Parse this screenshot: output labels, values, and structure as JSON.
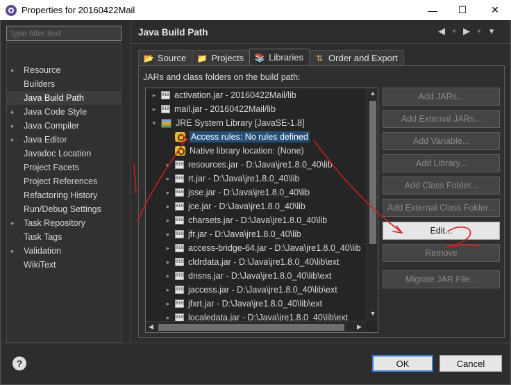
{
  "window": {
    "title": "Properties for 20160422Mail",
    "minimize_glyph": "—",
    "maximize_glyph": "☐",
    "close_glyph": "✕"
  },
  "filter": {
    "placeholder": "type filter text"
  },
  "nav": [
    {
      "label": "Resource",
      "arrow": "▸",
      "selected": false
    },
    {
      "label": "Builders",
      "arrow": "",
      "selected": false
    },
    {
      "label": "Java Build Path",
      "arrow": "",
      "selected": true
    },
    {
      "label": "Java Code Style",
      "arrow": "▸",
      "selected": false
    },
    {
      "label": "Java Compiler",
      "arrow": "▸",
      "selected": false
    },
    {
      "label": "Java Editor",
      "arrow": "▸",
      "selected": false
    },
    {
      "label": "Javadoc Location",
      "arrow": "",
      "selected": false
    },
    {
      "label": "Project Facets",
      "arrow": "",
      "selected": false
    },
    {
      "label": "Project References",
      "arrow": "",
      "selected": false
    },
    {
      "label": "Refactoring History",
      "arrow": "",
      "selected": false
    },
    {
      "label": "Run/Debug Settings",
      "arrow": "",
      "selected": false
    },
    {
      "label": "Task Repository",
      "arrow": "▸",
      "selected": false
    },
    {
      "label": "Task Tags",
      "arrow": "",
      "selected": false
    },
    {
      "label": "Validation",
      "arrow": "▸",
      "selected": false
    },
    {
      "label": "WikiText",
      "arrow": "",
      "selected": false
    }
  ],
  "header": {
    "title": "Java Build Path",
    "back_glyph": "◀",
    "forward_glyph": "▶",
    "menu_glyph": "▾"
  },
  "tabs": [
    {
      "label": "Source",
      "icon": "source-folder-icon",
      "active": false
    },
    {
      "label": "Projects",
      "icon": "projects-icon",
      "active": false
    },
    {
      "label": "Libraries",
      "icon": "libraries-icon",
      "active": true
    },
    {
      "label": "Order and Export",
      "icon": "order-export-icon",
      "active": false
    }
  ],
  "panel_label": "JARs and class folders on the build path:",
  "tree": [
    {
      "text": "activation.jar - 20160422Mail/lib",
      "indent": 0,
      "toggle": "▸",
      "icon": "jar",
      "selected": false
    },
    {
      "text": "mail.jar - 20160422Mail/lib",
      "indent": 0,
      "toggle": "▸",
      "icon": "jar",
      "selected": false
    },
    {
      "text": "JRE System Library [JavaSE-1.8]",
      "indent": 0,
      "toggle": "▾",
      "icon": "library",
      "selected": false
    },
    {
      "text": "Access rules: No rules defined",
      "indent": 1,
      "toggle": "",
      "icon": "rule",
      "selected": true
    },
    {
      "text": "Native library location: (None)",
      "indent": 1,
      "toggle": "",
      "icon": "rule",
      "selected": false
    },
    {
      "text": "resources.jar - D:\\Java\\jre1.8.0_40\\lib",
      "indent": 1,
      "toggle": "▸",
      "icon": "jar",
      "selected": false
    },
    {
      "text": "rt.jar - D:\\Java\\jre1.8.0_40\\lib",
      "indent": 1,
      "toggle": "▸",
      "icon": "jar",
      "selected": false
    },
    {
      "text": "jsse.jar - D:\\Java\\jre1.8.0_40\\lib",
      "indent": 1,
      "toggle": "▸",
      "icon": "jar",
      "selected": false
    },
    {
      "text": "jce.jar - D:\\Java\\jre1.8.0_40\\lib",
      "indent": 1,
      "toggle": "▸",
      "icon": "jar",
      "selected": false
    },
    {
      "text": "charsets.jar - D:\\Java\\jre1.8.0_40\\lib",
      "indent": 1,
      "toggle": "▸",
      "icon": "jar",
      "selected": false
    },
    {
      "text": "jfr.jar - D:\\Java\\jre1.8.0_40\\lib",
      "indent": 1,
      "toggle": "▸",
      "icon": "jar",
      "selected": false
    },
    {
      "text": "access-bridge-64.jar - D:\\Java\\jre1.8.0_40\\lib",
      "indent": 1,
      "toggle": "▸",
      "icon": "jar",
      "selected": false
    },
    {
      "text": "cldrdata.jar - D:\\Java\\jre1.8.0_40\\lib\\ext",
      "indent": 1,
      "toggle": "▸",
      "icon": "jar",
      "selected": false
    },
    {
      "text": "dnsns.jar - D:\\Java\\jre1.8.0_40\\lib\\ext",
      "indent": 1,
      "toggle": "▸",
      "icon": "jar",
      "selected": false
    },
    {
      "text": "jaccess.jar - D:\\Java\\jre1.8.0_40\\lib\\ext",
      "indent": 1,
      "toggle": "▸",
      "icon": "jar",
      "selected": false
    },
    {
      "text": "jfxrt.jar - D:\\Java\\jre1.8.0_40\\lib\\ext",
      "indent": 1,
      "toggle": "▸",
      "icon": "jar",
      "selected": false
    },
    {
      "text": "localedata.jar - D:\\Java\\jre1.8.0_40\\lib\\ext",
      "indent": 1,
      "toggle": "▸",
      "icon": "jar",
      "selected": false
    }
  ],
  "side_buttons": [
    {
      "label": "Add JARs...",
      "enabled": false
    },
    {
      "label": "Add External JARs...",
      "enabled": false
    },
    {
      "label": "Add Variable...",
      "enabled": false
    },
    {
      "label": "Add Library...",
      "enabled": false
    },
    {
      "label": "Add Class Folder...",
      "enabled": false
    },
    {
      "label": "Add External Class Folder...",
      "enabled": false
    },
    {
      "label": "Edit...",
      "enabled": true
    },
    {
      "label": "Remove",
      "enabled": false
    },
    {
      "label": "Migrate JAR File...",
      "enabled": false
    }
  ],
  "footer": {
    "help_glyph": "?",
    "ok_label": "OK",
    "cancel_label": "Cancel"
  },
  "annotations": {
    "color": "#cc1f1f",
    "step1_text": "1",
    "step2_text": "2"
  }
}
